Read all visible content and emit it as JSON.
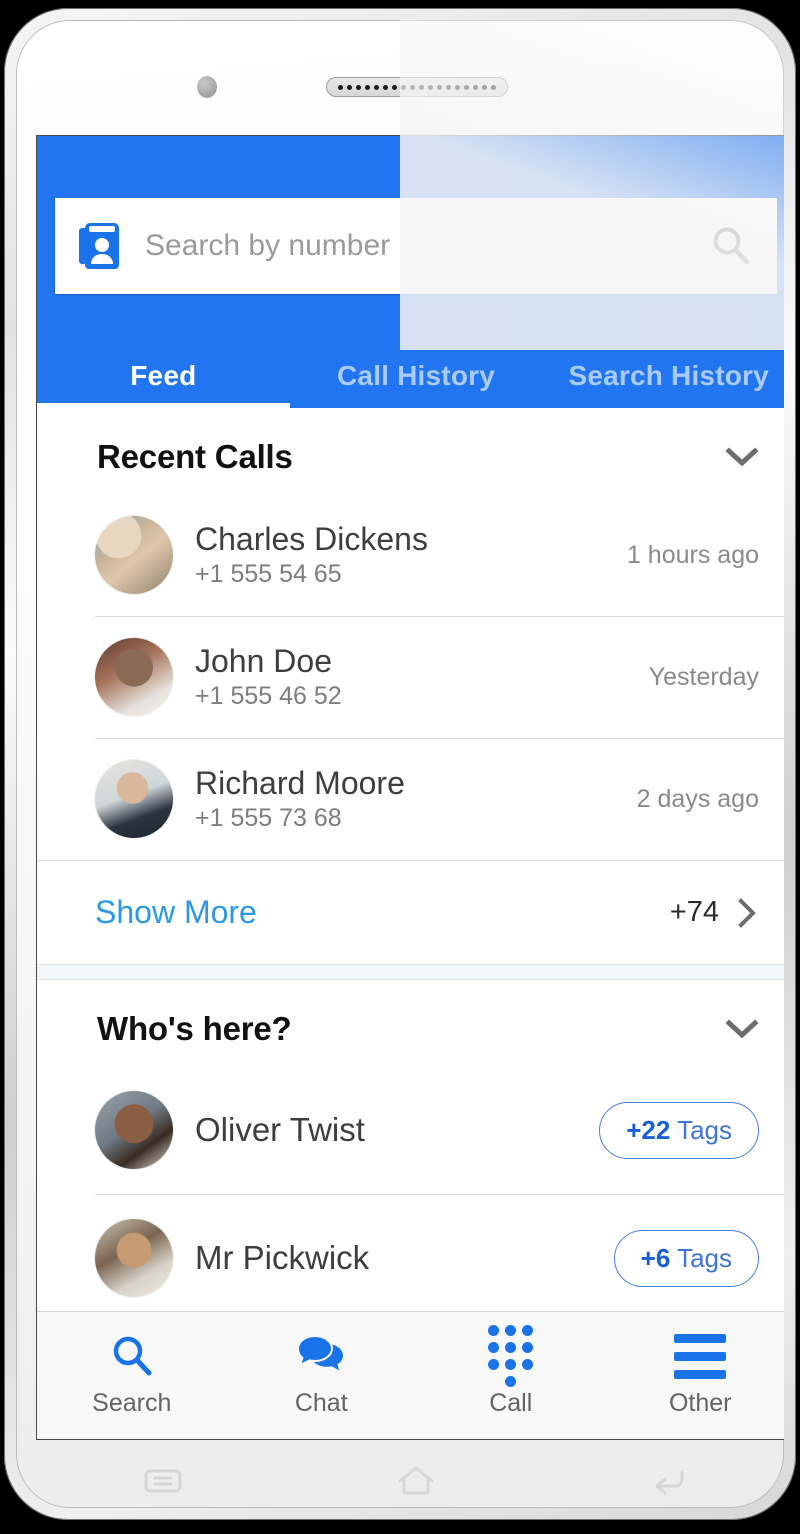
{
  "device": {
    "camera_icon": "camera-dot",
    "speaker_icon": "speaker-grille",
    "softkeys": [
      {
        "name": "recents",
        "icon": "recents-icon"
      },
      {
        "name": "home",
        "icon": "home-icon"
      },
      {
        "name": "back",
        "icon": "back-icon"
      }
    ]
  },
  "colors": {
    "header_blue": "#2175f0",
    "accent_blue": "#1a73e8",
    "link_blue": "#2f97e8",
    "tag_blue": "#3f74d8",
    "divider": "#dcdcdc",
    "section_gap": "#f4f7fa"
  },
  "search": {
    "placeholder": "Search by number",
    "value": "",
    "leading_icon": "contact-book-icon",
    "trailing_icon": "search-icon"
  },
  "tabs": [
    {
      "label": "Feed",
      "active": true
    },
    {
      "label": "Call History",
      "active": false
    },
    {
      "label": "Search History",
      "active": false
    }
  ],
  "sections": {
    "recent_calls": {
      "title": "Recent Calls",
      "collapse_icon": "chevron-down-icon",
      "items": [
        {
          "name": "Charles Dickens",
          "number": "+1 555 54 65",
          "time": "1 hours ago"
        },
        {
          "name": "John Doe",
          "number": "+1 555 46 52",
          "time": "Yesterday"
        },
        {
          "name": "Richard Moore",
          "number": "+1 555 73 68",
          "time": "2 days ago"
        }
      ],
      "show_more": {
        "label": "Show More",
        "count": "+74",
        "chevron_icon": "chevron-right-icon"
      }
    },
    "whos_here": {
      "title": "Who's here?",
      "collapse_icon": "chevron-down-icon",
      "items": [
        {
          "name": "Oliver Twist",
          "tag_count": "+22",
          "tag_label": "Tags"
        },
        {
          "name": "Mr Pickwick",
          "tag_count": "+6",
          "tag_label": "Tags"
        }
      ]
    }
  },
  "bottom_nav": [
    {
      "label": "Search",
      "icon": "search-icon"
    },
    {
      "label": "Chat",
      "icon": "chat-bubbles-icon"
    },
    {
      "label": "Call",
      "icon": "dialpad-icon"
    },
    {
      "label": "Other",
      "icon": "menu-icon"
    }
  ]
}
